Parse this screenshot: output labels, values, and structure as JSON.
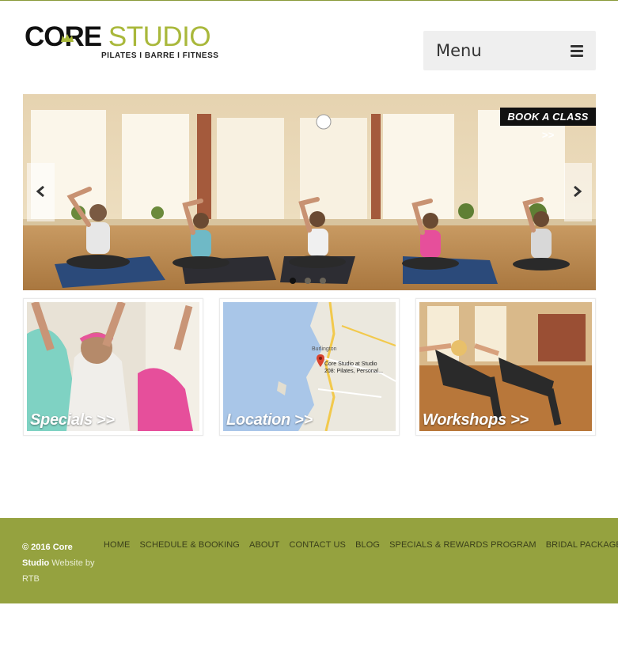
{
  "brand": {
    "name_part1": "CORE",
    "name_part2": "STUDIO",
    "tagline": "PILATES I BARRE I FITNESS",
    "accent_color": "#a9b83b"
  },
  "header": {
    "menu_label": "Menu",
    "menu_icon": "hamburger-icon"
  },
  "slider": {
    "book_label": "BOOK A CLASS >>",
    "prev_icon": "chevron-left-icon",
    "next_icon": "chevron-right-icon",
    "slide_count": 3,
    "active_slide": 1
  },
  "tiles": [
    {
      "label": "Specials >>"
    },
    {
      "label": "Location >>",
      "map_place": "Burlington",
      "map_pin_text_1": "Core Studio at Studio",
      "map_pin_text_2": "208: Pilates, Personal..."
    },
    {
      "label": "Workshops >>"
    }
  ],
  "footer": {
    "copyright": "© 2016 Core Studio",
    "credit_prefix": "Website by",
    "credit": "RTB",
    "nav": [
      "HOME",
      "SCHEDULE & BOOKING",
      "ABOUT",
      "CONTACT US",
      "BLOG",
      "SPECIALS & REWARDS PROGRAM",
      "BRIDAL PACKAGES"
    ],
    "background_color": "#95a23f"
  }
}
